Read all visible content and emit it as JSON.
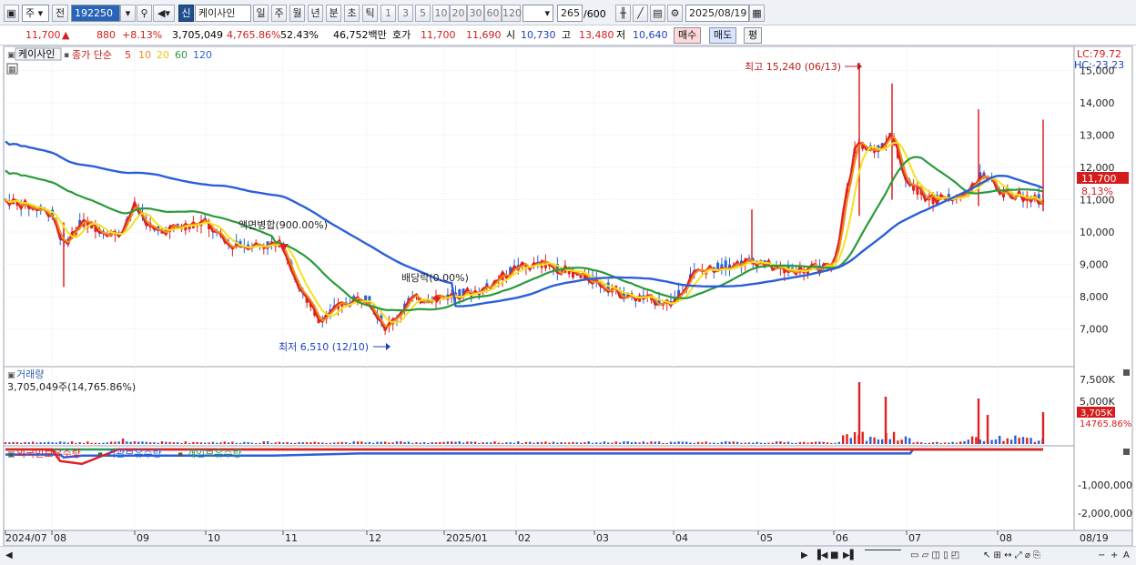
{
  "toolbar": {
    "period": "주",
    "prev_label": "전",
    "code": "192250",
    "name_badge": "신",
    "stock_name": "케이사인",
    "periods": [
      "일",
      "주",
      "월",
      "년",
      "분",
      "초",
      "틱"
    ],
    "intervals": [
      "1",
      "3",
      "5",
      "10",
      "20",
      "30",
      "60",
      "120"
    ],
    "count": "265",
    "count_total": "/600",
    "date": "2025/08/19"
  },
  "quote": {
    "price": "11,700",
    "change": "880",
    "change_pct": "+8.13%",
    "volume": "3,705,049",
    "volume_pct": "4,765.86%",
    "turnover_pct": "52.43%",
    "amount": "46,752백만",
    "ask_label": "호가",
    "ask1": "11,700",
    "ask2": "11,690",
    "open_label": "시",
    "open": "10,730",
    "high_label": "고",
    "high": "13,480",
    "low_label": "저",
    "low": "10,640",
    "buy": "매수",
    "sell": "매도",
    "eval": "평"
  },
  "price_pane": {
    "name": "케이사인",
    "legend_prefix": "종가 단순",
    "ma": [
      {
        "period": "5",
        "color": "#e02020"
      },
      {
        "period": "10",
        "color": "#f08c1a"
      },
      {
        "period": "20",
        "color": "#f4e21e"
      },
      {
        "period": "60",
        "color": "#2a9a3a"
      },
      {
        "period": "120",
        "color": "#2b5fd8"
      }
    ],
    "lc": "LC:79.72",
    "hc": "HC:-23.23",
    "high_note": "최고 15,240 (06/13)",
    "low_note": "최저 6,510 (12/10)",
    "event1": "액면병합(900.00%)",
    "event2": "배당락(0.00%)",
    "current_price": "11,700",
    "current_pct": "8.13%",
    "y_ticks": [
      "15,000",
      "14,000",
      "13,000",
      "12,000",
      "11,000",
      "10,000",
      "9,000",
      "8,000",
      "7,000"
    ]
  },
  "volume_pane": {
    "title": "거래량",
    "value": "3,705,049주(14,765.86%)",
    "y_ticks": [
      "7,500K",
      "5,000K"
    ],
    "badge": "3,705K",
    "badge_pct": "14765.86%"
  },
  "holdings_pane": {
    "series": [
      {
        "name": "외국인보유수량",
        "color": "#e02020"
      },
      {
        "name": "기관보유수량",
        "color": "#2b5fd8"
      },
      {
        "name": "개인보유수량",
        "color": "#2a9a5a"
      }
    ],
    "y_ticks": [
      "-1,000,000",
      "-2,000,000"
    ]
  },
  "x_axis": {
    "labels": [
      "2024/07",
      "08",
      "09",
      "10",
      "11",
      "12",
      "2025/01",
      "02",
      "03",
      "04",
      "05",
      "06",
      "07",
      "08"
    ],
    "right_label": "08/19"
  }
}
